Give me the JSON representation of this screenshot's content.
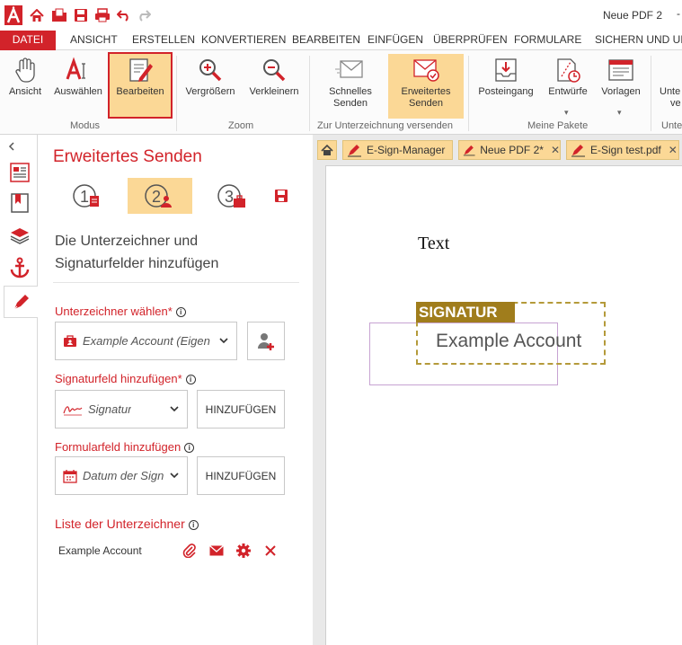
{
  "titlebar": {
    "document_title": "Neue PDF 2",
    "minimize": "-"
  },
  "menu": {
    "tabs": [
      "DATEI",
      "ANSICHT",
      "ERSTELLEN",
      "KONVERTIEREN",
      "BEARBEITEN",
      "EINFÜGEN",
      "ÜBERPRÜFEN",
      "FORMULARE",
      "SICHERN UND UNT"
    ]
  },
  "ribbon": {
    "buttons": {
      "ansicht": "Ansicht",
      "auswaehlen": "Auswählen",
      "bearbeiten": "Bearbeiten",
      "vergroessern": "Vergrößern",
      "verkleinern": "Verkleinern",
      "schnelles_senden_1": "Schnelles",
      "schnelles_senden_2": "Senden",
      "erweitertes_senden_1": "Erweitertes",
      "erweitertes_senden_2": "Senden",
      "posteingang": "Posteingang",
      "entwuerfe": "Entwürfe",
      "vorlagen": "Vorlagen",
      "cut_1": "Unte",
      "cut_2": "ve"
    },
    "groups": {
      "modus": "Modus",
      "zoom": "Zoom",
      "zur_unterzeichnung": "Zur Unterzeichnung versenden",
      "meine_pakete": "Meine Pakete",
      "cut": "Unte"
    }
  },
  "panel": {
    "title": "Erweitertes Senden",
    "description": "Die Unterzeichner und Signaturfelder hinzufügen",
    "signer_label": "Unterzeichner wählen",
    "signer_value": "Example Account (Eigen",
    "sigfield_label": "Signaturfeld hinzufügen",
    "sigfield_value": "Signatur",
    "sigfield_button": "HINZUFÜGEN",
    "formfield_label": "Formularfeld hinzufügen",
    "formfield_value": "Datum der Sign",
    "formfield_button": "HINZUFÜGEN",
    "required_mark": "*",
    "info_mark": "i",
    "list_title": "Liste der Unterzeichner",
    "signers": [
      {
        "name": "Example Account"
      }
    ]
  },
  "doc_tabs": [
    {
      "label": "E-Sign-Manager",
      "closable": false
    },
    {
      "label": "Neue PDF 2*",
      "closable": true
    },
    {
      "label": "E-Sign test.pdf",
      "closable": true
    }
  ],
  "document": {
    "text": "Text",
    "signature_tag": "SIGNATUR",
    "signature_name": "Example Account"
  },
  "colors": {
    "accent_red": "#d2232a",
    "selected_bg": "#fbd896",
    "signature_gold": "#a07d1c"
  }
}
